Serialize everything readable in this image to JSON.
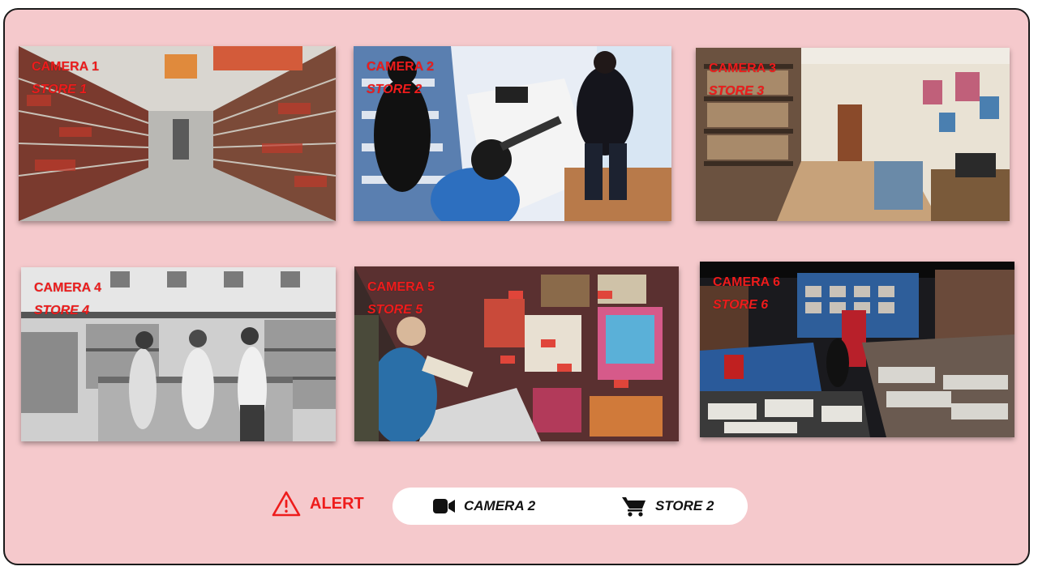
{
  "feeds": [
    {
      "camera": "CAMERA 1",
      "store": "STORE 1"
    },
    {
      "camera": "CAMERA 2",
      "store": "STORE 2"
    },
    {
      "camera": "CAMERA 3",
      "store": "STORE 3"
    },
    {
      "camera": "CAMERA 4",
      "store": "STORE 4"
    },
    {
      "camera": "CAMERA 5",
      "store": "STORE 5"
    },
    {
      "camera": "CAMERA 6",
      "store": "STORE 6"
    }
  ],
  "alert": {
    "label": "ALERT",
    "icon": "warning-triangle-icon",
    "color": "#ee1c1c"
  },
  "status": {
    "camera_icon": "video-camera-icon",
    "camera_label": "CAMERA 2",
    "store_icon": "shopping-cart-icon",
    "store_label": "STORE 2"
  },
  "colors": {
    "background": "#f5c9cc",
    "overlay_text": "#ee1c1c",
    "pill": "#ffffff"
  }
}
